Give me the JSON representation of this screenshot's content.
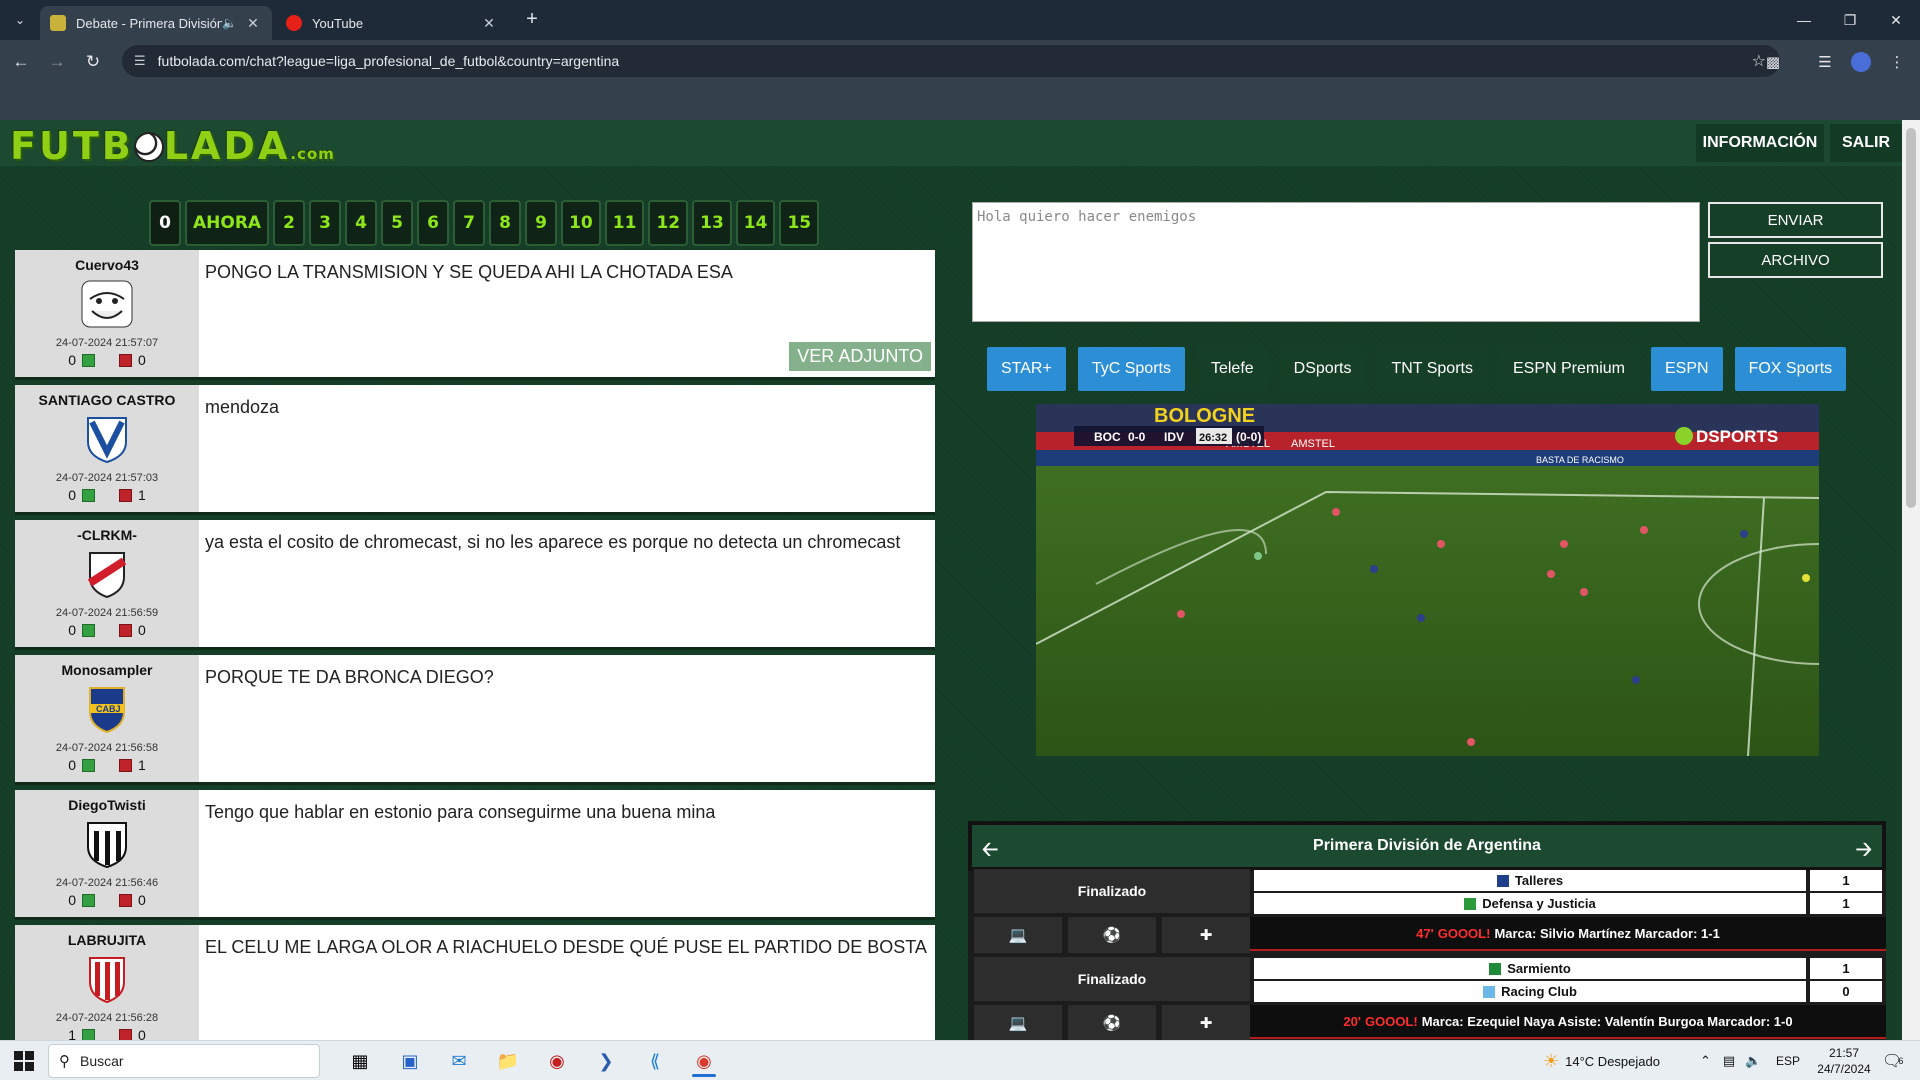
{
  "browser": {
    "tabs": [
      {
        "title": "Debate - Primera División d",
        "active": true
      },
      {
        "title": "YouTube",
        "active": false
      }
    ],
    "url": "futbolada.com/chat?league=liga_profesional_de_futbol&country=argentina"
  },
  "site": {
    "logo": "FUTB",
    "logo_rest": "LADA",
    "logo_suffix": ".com",
    "info_button": "INFORMACIÓN",
    "logout_button": "SALIR"
  },
  "pages": [
    "0",
    "AHORA",
    "2",
    "3",
    "4",
    "5",
    "6",
    "7",
    "8",
    "9",
    "10",
    "11",
    "12",
    "13",
    "14",
    "15"
  ],
  "messages": [
    {
      "user": "Cuervo43",
      "avatar": "troll-face-icon",
      "date": "24-07-2024 21:57:07",
      "up": "0",
      "down": "0",
      "text": "PONGO LA TRANSMISION Y SE QUEDA AHI LA CHOTADA ESA",
      "attachment": "VER ADJUNTO"
    },
    {
      "user": "SANTIAGO CASTRO",
      "avatar": "velez-crest-icon",
      "date": "24-07-2024 21:57:03",
      "up": "0",
      "down": "1",
      "text": "mendoza"
    },
    {
      "user": "-CLRKM-",
      "avatar": "river-crest-icon",
      "date": "24-07-2024 21:56:59",
      "up": "0",
      "down": "0",
      "text": "ya esta el cosito de chromecast, si no les aparece es porque no detecta un chromecast"
    },
    {
      "user": "Monosampler",
      "avatar": "boca-crest-icon",
      "date": "24-07-2024 21:56:58",
      "up": "0",
      "down": "1",
      "text": "PORQUE TE DA BRONCA DIEGO?"
    },
    {
      "user": "DiegoTwisti",
      "avatar": "chaco-crest-icon",
      "date": "24-07-2024 21:56:46",
      "up": "0",
      "down": "0",
      "text": "Tengo que hablar en estonio para conseguirme una buena mina"
    },
    {
      "user": "LABRUJITA",
      "avatar": "estudiantes-crest-icon",
      "date": "24-07-2024 21:56:28",
      "up": "1",
      "down": "0",
      "text": "EL CELU ME LARGA OLOR A RIACHUELO DESDE QUÉ PUSE EL PARTIDO DE BOSTA"
    }
  ],
  "composer": {
    "placeholder": "Hola quiero hacer enemigos",
    "send_button": "ENVIAR",
    "file_button": "ARCHIVO"
  },
  "channels": [
    {
      "label": "STAR+",
      "style": "blue"
    },
    {
      "label": "TyC Sports",
      "style": "blue"
    },
    {
      "label": "Telefe",
      "style": "dark"
    },
    {
      "label": "DSports",
      "style": "dark"
    },
    {
      "label": "TNT Sports",
      "style": "dark"
    },
    {
      "label": "ESPN Premium",
      "style": "dark"
    },
    {
      "label": "ESPN",
      "style": "blue"
    },
    {
      "label": "FOX Sports",
      "style": "blue"
    }
  ],
  "video": {
    "home": "BOC",
    "score": "0-0",
    "away": "IDV",
    "clock": "26:32",
    "aggregate": "(0-0)",
    "broadcaster": "DSPORTS",
    "ad1": "BOLOGNE",
    "ad2": "AMSTEL",
    "ad3": "AMSTEL",
    "ad4": "BASTA DE RACISMO"
  },
  "league": {
    "title": "Primera División de Argentina",
    "matches": [
      {
        "status": "Finalizado",
        "home": "Talleres",
        "home_score": "1",
        "away": "Defensa y Justicia",
        "away_score": "1",
        "event_minute": "47'",
        "event_goal": "GOOOL!",
        "event_text": "Marca: Silvio Martínez Marcador: 1-1"
      },
      {
        "status": "Finalizado",
        "home": "Sarmiento",
        "home_score": "1",
        "away": "Racing Club",
        "away_score": "0",
        "event_minute": "20'",
        "event_goal": "GOOOL!",
        "event_text": "Marca: Ezequiel Naya Asiste: Valentín Burgoa Marcador: 1-0"
      }
    ]
  },
  "taskbar": {
    "search": "Buscar",
    "weather": "14°C  Despejado",
    "lang": "ESP",
    "time": "21:57",
    "date": "24/7/2024",
    "notifications": "6"
  },
  "colors": {
    "page_bg": "#17432b",
    "page_number_text": "#8ee61a",
    "channel_blue": "#2c8fd6",
    "goal_red": "#ff2d2d"
  }
}
